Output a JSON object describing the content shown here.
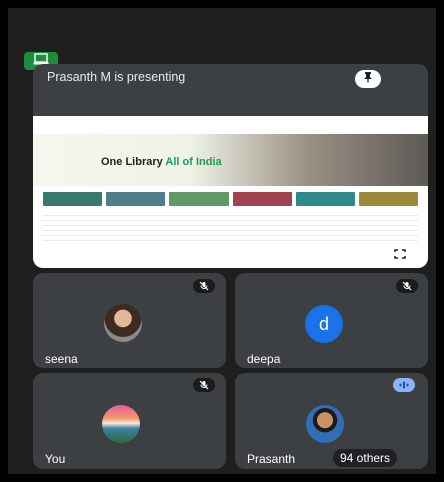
{
  "presenting": {
    "label": "Prasanth M is presenting",
    "screen": {
      "hero_title_a": "One Library",
      "hero_title_b": "All of India"
    }
  },
  "participants": [
    {
      "name": "seena"
    },
    {
      "name": "deepa",
      "initial": "d",
      "avatar_color": "#1a73e8"
    },
    {
      "name": "You"
    },
    {
      "name": "Prasanth",
      "others": "94 others"
    }
  ],
  "colors": {
    "background": "#1f1f1f",
    "tile": "#3c4043",
    "cast_green": "#1e8e3e",
    "speaking_blue": "#8ab4f8"
  },
  "icons": [
    "cast-icon",
    "pin-icon",
    "fullscreen-icon",
    "mic-off-icon",
    "speaking-icon"
  ]
}
